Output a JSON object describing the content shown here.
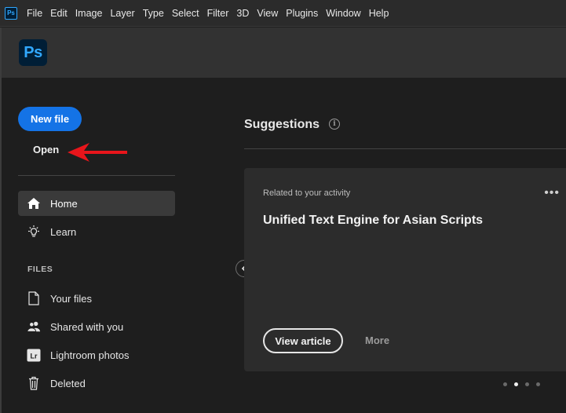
{
  "menubar": {
    "app_icon_label": "Ps",
    "items": [
      "File",
      "Edit",
      "Image",
      "Layer",
      "Type",
      "Select",
      "Filter",
      "3D",
      "View",
      "Plugins",
      "Window",
      "Help"
    ]
  },
  "header": {
    "logo_text": "Ps"
  },
  "sidebar": {
    "new_file_label": "New file",
    "open_label": "Open",
    "nav": [
      {
        "label": "Home",
        "icon": "home-icon",
        "active": true
      },
      {
        "label": "Learn",
        "icon": "lightbulb-icon",
        "active": false
      }
    ],
    "files_heading": "FILES",
    "files": [
      {
        "label": "Your files",
        "icon": "document-icon"
      },
      {
        "label": "Shared with you",
        "icon": "people-icon"
      },
      {
        "label": "Lightroom photos",
        "icon": "lightroom-icon"
      },
      {
        "label": "Deleted",
        "icon": "trash-icon"
      }
    ]
  },
  "main": {
    "suggestions_title": "Suggestions",
    "info_glyph": "i",
    "card": {
      "label": "Related to your activity",
      "title": "Unified Text Engine for Asian Scripts",
      "more_menu_glyph": "•••",
      "view_article_label": "View article",
      "more_label": "More"
    },
    "carousel": {
      "count": 4,
      "active_index": 1
    }
  },
  "colors": {
    "accent": "#1473e6",
    "ps_brand": "#31a8ff",
    "annotation_arrow": "#e8151b"
  }
}
